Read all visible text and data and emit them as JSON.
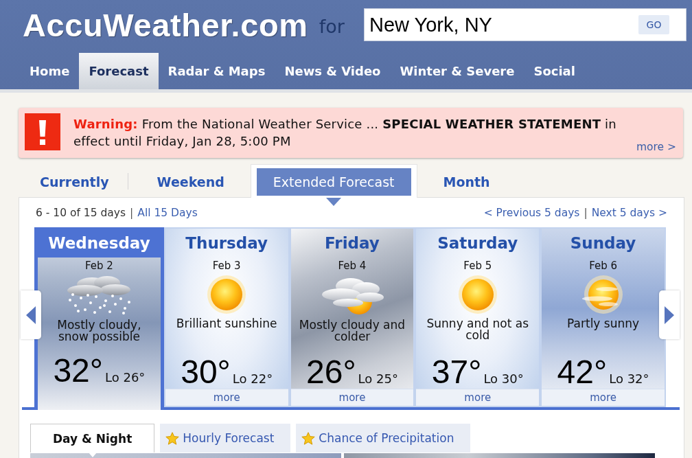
{
  "header": {
    "logo": "AccuWeather.com",
    "for_label": "for",
    "location_search": {
      "value": "New York, NY",
      "button": "GO"
    }
  },
  "nav": [
    {
      "label": "Home",
      "selected": false
    },
    {
      "label": "Forecast",
      "selected": true
    },
    {
      "label": "Radar & Maps",
      "selected": false
    },
    {
      "label": "News & Video",
      "selected": false
    },
    {
      "label": "Winter & Severe",
      "selected": false
    },
    {
      "label": "Social",
      "selected": false
    }
  ],
  "alert": {
    "kind": "warning",
    "label": "Warning:",
    "message": "From the National Weather Service ... **SPECIAL WEATHER STATEMENT** in effect until Friday, Jan 28, 5:00 PM",
    "more_link": "more >"
  },
  "forecast_tabs": [
    {
      "label": "Currently",
      "selected": false
    },
    {
      "label": "Weekend",
      "selected": false
    },
    {
      "label": "Extended Forecast",
      "selected": true
    },
    {
      "label": "Month",
      "selected": false
    }
  ],
  "range": {
    "summary": "6 - 10 of 15 days",
    "separator": "|",
    "all_link": "All 15 Days"
  },
  "pager": {
    "previous": "< Previous 5 days",
    "separator": "|",
    "next": "Next 5 days >"
  },
  "days": [
    {
      "day": "Wednesday",
      "date": "Feb 2",
      "kind": "snow",
      "description": "Mostly cloudy, snow possible",
      "high": "32°",
      "low": "Lo 26°",
      "selected": true
    },
    {
      "day": "Thursday",
      "date": "Feb 3",
      "kind": "sunny",
      "description": "Brilliant sunshine",
      "high": "30°",
      "low": "Lo 22°",
      "more": "more",
      "selected": false
    },
    {
      "day": "Friday",
      "date": "Feb 4",
      "kind": "cloudy",
      "description": "Mostly cloudy and colder",
      "high": "26°",
      "low": "Lo 25°",
      "more": "more",
      "selected": false
    },
    {
      "day": "Saturday",
      "date": "Feb 5",
      "kind": "sunny",
      "description": "Sunny and not as cold",
      "high": "37°",
      "low": "Lo 30°",
      "more": "more",
      "selected": false
    },
    {
      "day": "Sunday",
      "date": "Feb 6",
      "kind": "partly-sunny",
      "description": "Partly sunny",
      "high": "42°",
      "low": "Lo 32°",
      "more": "more",
      "selected": false
    }
  ],
  "detail_tabs": [
    {
      "label": "Day & Night",
      "selected": true,
      "starred": false
    },
    {
      "label": "Hourly Forecast",
      "selected": false,
      "starred": true
    },
    {
      "label": "Chance of Precipitation",
      "selected": false,
      "starred": true
    }
  ]
}
